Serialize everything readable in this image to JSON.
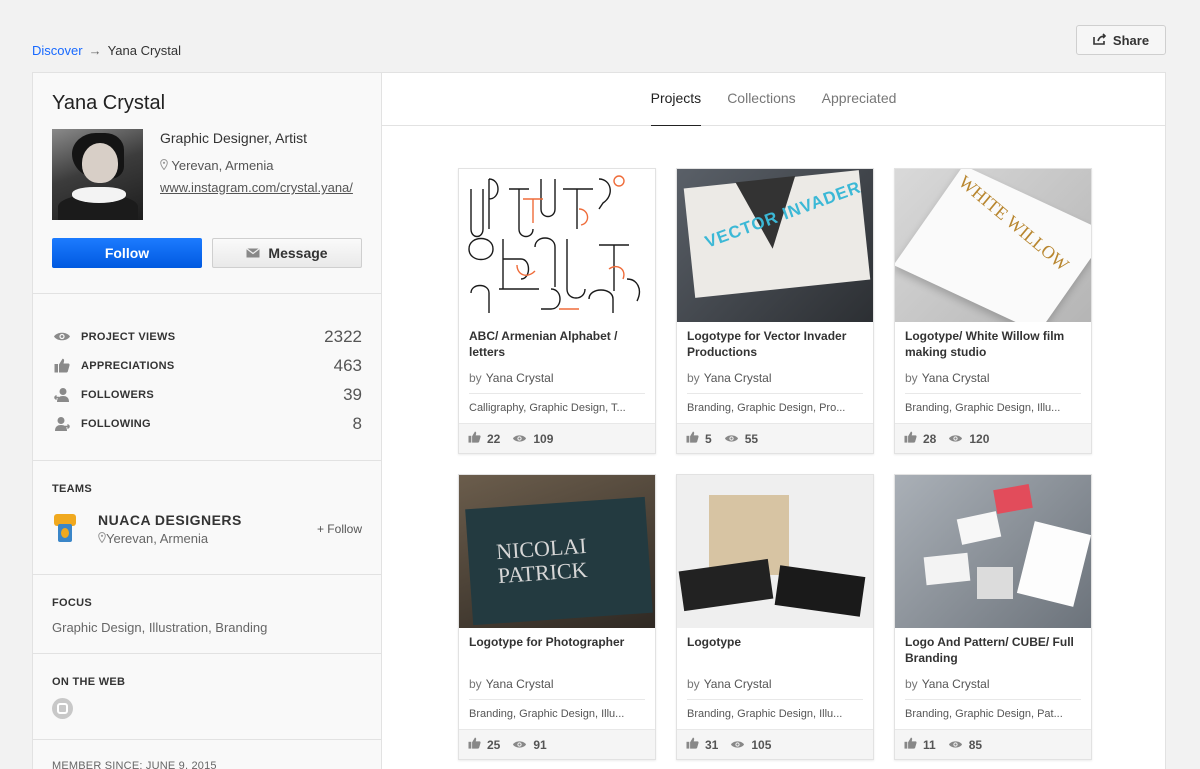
{
  "breadcrumb": {
    "root": "Discover",
    "arrow": "→",
    "current": "Yana Crystal"
  },
  "share": {
    "label": "Share",
    "icon": "share-icon"
  },
  "profile": {
    "name": "Yana Crystal",
    "title": "Graphic Designer, Artist",
    "location": "Yerevan, Armenia",
    "website": "www.instagram.com/crystal.yana/",
    "follow_label": "Follow",
    "message_label": "Message"
  },
  "stats": [
    {
      "label": "PROJECT VIEWS",
      "value": "2322",
      "icon": "eye-icon"
    },
    {
      "label": "APPRECIATIONS",
      "value": "463",
      "icon": "thumbs-up-icon"
    },
    {
      "label": "FOLLOWERS",
      "value": "39",
      "icon": "followers-icon"
    },
    {
      "label": "FOLLOWING",
      "value": "8",
      "icon": "following-icon"
    }
  ],
  "teams": {
    "title": "TEAMS",
    "items": [
      {
        "name": "NUACA DESIGNERS",
        "location": "Yerevan, Armenia",
        "follow_label": "+ Follow"
      }
    ]
  },
  "focus": {
    "title": "FOCUS",
    "text": "Graphic Design, Illustration, Branding"
  },
  "web": {
    "title": "ON THE WEB",
    "icon": "instagram-icon"
  },
  "member": {
    "text": "MEMBER SINCE: JUNE 9, 2015"
  },
  "tabs": [
    {
      "label": "Projects",
      "active": true
    },
    {
      "label": "Collections",
      "active": false
    },
    {
      "label": "Appreciated",
      "active": false
    }
  ],
  "projects": [
    {
      "title": "ABC/ Armenian Alphabet / letters",
      "by": "by",
      "owner": "Yana Crystal",
      "fields": "Calligraphy, Graphic Design, T...",
      "likes": "22",
      "views": "109"
    },
    {
      "title": "Logotype for Vector Invader Productions",
      "by": "by",
      "owner": "Yana Crystal",
      "fields": "Branding, Graphic Design, Pro...",
      "likes": "5",
      "views": "55"
    },
    {
      "title": "Logotype/ White Willow film making studio",
      "by": "by",
      "owner": "Yana Crystal",
      "fields": "Branding, Graphic Design, Illu...",
      "likes": "28",
      "views": "120"
    },
    {
      "title": "Logotype for Photographer",
      "by": "by",
      "owner": "Yana Crystal",
      "fields": "Branding, Graphic Design, Illu...",
      "likes": "25",
      "views": "91"
    },
    {
      "title": "Logotype",
      "by": "by",
      "owner": "Yana Crystal",
      "fields": "Branding, Graphic Design, Illu...",
      "likes": "31",
      "views": "105"
    },
    {
      "title": "Logo And Pattern/ CUBE/ Full Branding",
      "by": "by",
      "owner": "Yana Crystal",
      "fields": "Branding, Graphic Design, Pat...",
      "likes": "11",
      "views": "85"
    }
  ],
  "thumb_text": {
    "vector": "VECTOR INVADER",
    "willow": "WHITE WILLOW",
    "photo1": "NICOLAI",
    "photo2": "PATRICK"
  },
  "colors": {
    "accent": "#1769ff",
    "follow_button": "#0a6cff"
  }
}
